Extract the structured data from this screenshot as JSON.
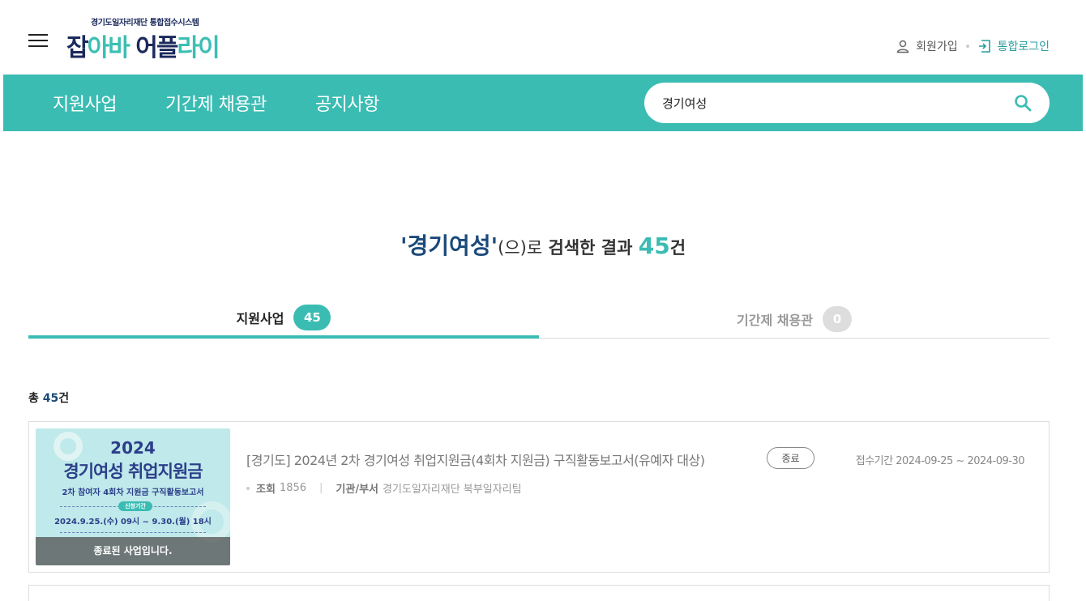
{
  "header": {
    "logo_subtitle": "경기도일자리재단 통합접수시스템",
    "logo_part1": "잡",
    "logo_part2": "아바 ",
    "logo_part3": "어",
    "logo_part4": "플",
    "logo_part5": "라이",
    "join_label": "회원가입",
    "login_label": "통합로그인"
  },
  "nav": {
    "items": [
      "지원사업",
      "기간제 채용관",
      "공지사항"
    ]
  },
  "search": {
    "value": "경기여성"
  },
  "result": {
    "keyword": "'경기여성'",
    "suffix": "(으)로",
    "middle": " 검색한 결과 ",
    "count": "45",
    "unit": "건"
  },
  "tabs": [
    {
      "label": "지원사업",
      "count": "45",
      "active": true
    },
    {
      "label": "기간제 채용관",
      "count": "0",
      "active": false
    }
  ],
  "total": {
    "prefix": "총 ",
    "count": "45",
    "unit": "건"
  },
  "items": [
    {
      "thumb": {
        "year": "2024",
        "title": "경기여성 취업지원금",
        "subtitle": "2차 참여자 4회차 지원금 구직활동보고서",
        "pill": "신청기간",
        "dates": "2024.9.25.(수) 09시 ~ 9.30.(월) 18시",
        "overlay": "종료된 사업입니다."
      },
      "title": "[경기도] 2024년 2차 경기여성 취업지원금(4회차 지원금) 구직활동보고서(유예자 대상)",
      "status": "종료",
      "period_label": "접수기간",
      "period": "2024-09-25 ~ 2024-09-30",
      "views_label": "조회",
      "views": "1856",
      "dept_label": "기관/부서",
      "dept": "경기도일자리재단 북부일자리팀"
    }
  ],
  "colors": {
    "accent": "#3bbcb3",
    "navy": "#1b4a7a"
  }
}
